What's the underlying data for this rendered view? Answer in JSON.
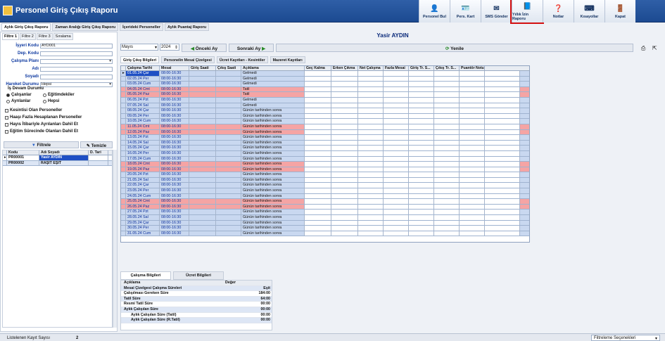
{
  "app": {
    "title": "Personel Giriş Çıkış Raporu"
  },
  "toolbar": [
    {
      "label": "Personel Bul",
      "icon": "search-person-icon"
    },
    {
      "label": "Pers. Kart",
      "icon": "person-card-icon"
    },
    {
      "label": "SMS Gönder",
      "icon": "sms-icon"
    },
    {
      "label": "Yıllık İzin Raporu",
      "icon": "report-icon"
    },
    {
      "label": "Notlar",
      "icon": "help-icon"
    },
    {
      "label": "Kısayollar",
      "icon": "shortcut-icon"
    },
    {
      "label": "Kapat",
      "icon": "close-door-icon"
    }
  ],
  "tabs": [
    "Aylık Giriş Çıkış Raporu",
    "Zaman Aralığı Giriş Çıkış Raporu",
    "İçerideki Personeller",
    "Aylık Puantaj Raporu"
  ],
  "left": {
    "filter_tabs": [
      "Filtre 1",
      "Filtre 2",
      "Filtre 3",
      "Sıralama"
    ],
    "fields": [
      {
        "label": "İşyeri Kodu",
        "value": "AYD001"
      },
      {
        "label": "Dep. Kodu",
        "value": ""
      },
      {
        "label": "Çalışma Planı",
        "value": ""
      },
      {
        "label": "Adı",
        "value": ""
      },
      {
        "label": "Soyadı",
        "value": ""
      },
      {
        "label": "Hareket Durumu",
        "value": "Hepsi"
      }
    ],
    "devam_label": "İş Devam Durumu",
    "radios": [
      "Çalışanlar",
      "Eğitimdekiler",
      "Ayrılanlar",
      "Hepsi"
    ],
    "checks": [
      "Kesintisi Olan Personeller",
      "Haaşı Fazla Hesaplanan Personeller",
      "Hayıs İtibariyle Ayrılanları Dahil Et",
      "Eğitim Sürecinde Olanları Dahil Et"
    ],
    "filter_btn": "Filtrele",
    "clear_btn": "Temizle",
    "cols": [
      "Kodu",
      "Adı Soyadı",
      "D. Tari"
    ],
    "rows": [
      {
        "kod": "PR00001",
        "ad": "Yasir AYDIN"
      },
      {
        "kod": "PR00002",
        "ad": "RAŞİT EŞİT"
      }
    ]
  },
  "person": "Yasir AYDIN",
  "controls": {
    "month": "Mayıs",
    "year": "2024",
    "prev": "Önceki Ay",
    "next": "Sonraki Ay",
    "refresh": "Yenile"
  },
  "subtabs": [
    "Giriş Çıkış Bilgileri",
    "Personelin Mesai Çizelgesi",
    "Ücret Kayıtları - Kesintiler",
    "Mazeret Kayıtları"
  ],
  "grid_cols": [
    "",
    "Çalışma Tarihi",
    "Mesai",
    "Giriş Saati",
    "Çıkış Saati",
    "Açıklama",
    "Geç Kalma",
    "Erken Çıkma",
    "Net Çalışma",
    "Fazla Mesai",
    "Giriş Tr. S...",
    "Çıkış Tr. S...",
    "Puantör Notu"
  ],
  "grid_rows": [
    {
      "d": "01.05.24 Çar",
      "m": "08:00-16:30",
      "a": "Gelmedi",
      "r": false
    },
    {
      "d": "02.05.24 Per",
      "m": "08:00-16:30",
      "a": "Gelmedi",
      "r": false
    },
    {
      "d": "03.05.24 Cum",
      "m": "08:00-16:30",
      "a": "Gelmedi",
      "r": false
    },
    {
      "d": "04.05.24 Cmt",
      "m": "08:00-16:30",
      "a": "Tatil",
      "r": true
    },
    {
      "d": "05.05.24 Paz",
      "m": "08:00-16:30",
      "a": "Tatil",
      "r": true
    },
    {
      "d": "06.05.24 Pzt",
      "m": "08:00-16:30",
      "a": "Gelmedi",
      "r": false
    },
    {
      "d": "07.05.24 Sal",
      "m": "08:00-16:30",
      "a": "Gelmedi",
      "r": false
    },
    {
      "d": "08.05.24 Çar",
      "m": "08:00-16:30",
      "a": "Günün tarihinden sonra",
      "r": false
    },
    {
      "d": "09.05.24 Per",
      "m": "08:00-16:30",
      "a": "Günün tarihinden sonra",
      "r": false
    },
    {
      "d": "10.05.24 Cum",
      "m": "08:00-16:30",
      "a": "Günün tarihinden sonra",
      "r": false
    },
    {
      "d": "11.05.24 Cmt",
      "m": "08:00-16:30",
      "a": "Günün tarihinden sonra",
      "r": true
    },
    {
      "d": "12.05.24 Paz",
      "m": "08:00-16:30",
      "a": "Günün tarihinden sonra",
      "r": true
    },
    {
      "d": "13.05.24 Pzt",
      "m": "08:00-16:30",
      "a": "Günün tarihinden sonra",
      "r": false
    },
    {
      "d": "14.05.24 Sal",
      "m": "08:00-16:30",
      "a": "Günün tarihinden sonra",
      "r": false
    },
    {
      "d": "15.05.24 Çar",
      "m": "08:00-16:30",
      "a": "Günün tarihinden sonra",
      "r": false
    },
    {
      "d": "16.05.24 Per",
      "m": "08:00-16:30",
      "a": "Günün tarihinden sonra",
      "r": false
    },
    {
      "d": "17.05.24 Cum",
      "m": "08:00-16:30",
      "a": "Günün tarihinden sonra",
      "r": false
    },
    {
      "d": "18.05.24 Cmt",
      "m": "08:00-16:30",
      "a": "Günün tarihinden sonra",
      "r": true
    },
    {
      "d": "19.05.24 Paz",
      "m": "08:00-16:30",
      "a": "Günün tarihinden sonra",
      "r": true
    },
    {
      "d": "20.05.24 Pzt",
      "m": "08:00-16:30",
      "a": "Günün tarihinden sonra",
      "r": false
    },
    {
      "d": "21.05.24 Sal",
      "m": "08:00-16:30",
      "a": "Günün tarihinden sonra",
      "r": false
    },
    {
      "d": "22.05.24 Çar",
      "m": "08:00-16:30",
      "a": "Günün tarihinden sonra",
      "r": false
    },
    {
      "d": "23.05.24 Per",
      "m": "08:00-16:30",
      "a": "Günün tarihinden sonra",
      "r": false
    },
    {
      "d": "24.05.24 Cum",
      "m": "08:00-16:30",
      "a": "Günün tarihinden sonra",
      "r": false
    },
    {
      "d": "25.05.24 Cmt",
      "m": "08:00-16:30",
      "a": "Günün tarihinden sonra",
      "r": true
    },
    {
      "d": "26.05.24 Paz",
      "m": "08:00-16:30",
      "a": "Günün tarihinden sonra",
      "r": true
    },
    {
      "d": "27.05.24 Pzt",
      "m": "08:00-16:30",
      "a": "Günün tarihinden sonra",
      "r": false
    },
    {
      "d": "28.05.24 Sal",
      "m": "08:00-16:30",
      "a": "Günün tarihinden sonra",
      "r": false
    },
    {
      "d": "29.05.24 Çar",
      "m": "08:00-16:30",
      "a": "Günün tarihinden sonra",
      "r": false
    },
    {
      "d": "30.05.24 Per",
      "m": "08:00-16:30",
      "a": "Günün tarihinden sonra",
      "r": false
    },
    {
      "d": "31.05.24 Cum",
      "m": "08:00-16:30",
      "a": "Günün tarihinden sonra",
      "r": false
    }
  ],
  "bottom_tabs": [
    "Çalışma Bilgileri",
    "Ücret Bilgileri"
  ],
  "summary_cols": [
    "Açıklama",
    "Değer"
  ],
  "summary_rows": [
    {
      "a": "Mesai Çizelgesi Çalışma Süreleri",
      "v": "Eşit"
    },
    {
      "a": "Çalışılması Gereken Süre",
      "v": "184:00"
    },
    {
      "a": "Tatil Süre",
      "v": "64:00"
    },
    {
      "a": "Resmi Tatil Süre",
      "v": "00:00"
    },
    {
      "a": "Aylık Çalışılan Süre",
      "v": "00:00"
    },
    {
      "a": "Aylık Çalışılan Süre (Tatil)",
      "v": "00:00"
    },
    {
      "a": "Aylık Çalışılan Süre (R.Tatil)",
      "v": "00:00"
    }
  ],
  "status": {
    "label": "Listelenen Kayıt Sayısı",
    "count": "2",
    "filter_opts": "Filtreleme Seçenekleri"
  }
}
